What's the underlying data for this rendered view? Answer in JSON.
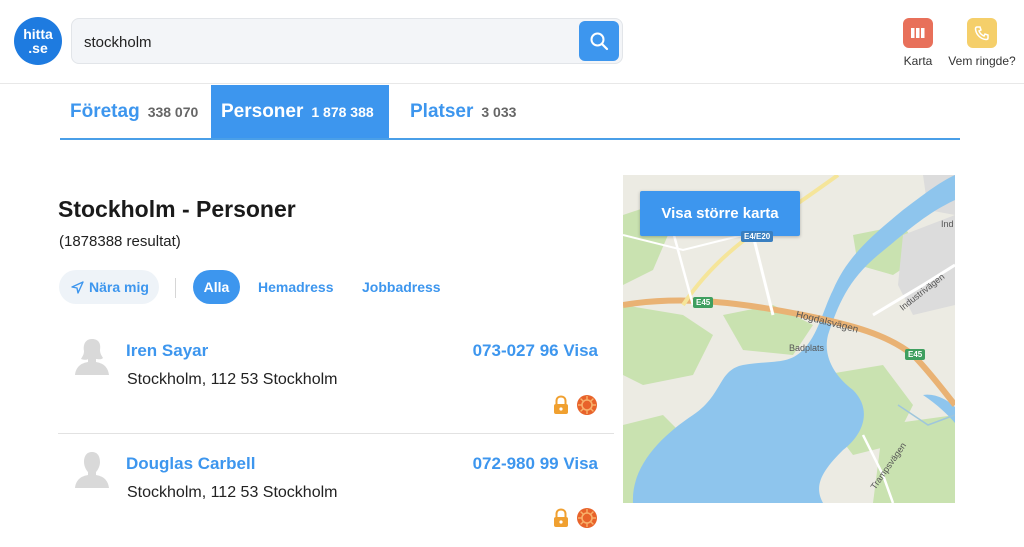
{
  "header": {
    "logo_line1": "hitta",
    "logo_line2": ".se",
    "search_value": "stockholm",
    "actions": [
      {
        "label": "Karta",
        "icon": "map-icon",
        "color": "#e8705a"
      },
      {
        "label": "Vem ringde?",
        "icon": "phone-icon",
        "color": "#f5cf6a"
      }
    ]
  },
  "tabs": [
    {
      "label": "Företag",
      "count": "338 070",
      "active": false
    },
    {
      "label": "Personer",
      "count": "1 878 388",
      "active": true
    },
    {
      "label": "Platser",
      "count": "3 033",
      "active": false
    }
  ],
  "main": {
    "title": "Stockholm - Personer",
    "results": "(1878388 resultat)"
  },
  "filters": {
    "near": "Nära mig",
    "all": "Alla",
    "home": "Hemadress",
    "work": "Jobbadress"
  },
  "people": [
    {
      "name": "Iren Sayar",
      "address": "Stockholm, 112 53 Stockholm",
      "phone": "073-027 96 Visa",
      "avatar": "female-avatar-icon"
    },
    {
      "name": "Douglas Carbell",
      "address": "Stockholm, 112 53 Stockholm",
      "phone": "072-980 99 Visa",
      "avatar": "male-avatar-icon"
    }
  ],
  "map": {
    "button": "Visa större karta",
    "labels": {
      "road": "Hogdalsvägen",
      "badplats": "Badplats",
      "industri": "Industrivägen",
      "ind": "Ind",
      "tramp": "Trampsvägen",
      "e45_a": "E45",
      "e45_b": "E45",
      "e4": "E4/E20"
    }
  },
  "colors": {
    "accent": "#3d96ee",
    "water": "#8ec5ed",
    "green": "#c9e2b0",
    "road_orange": "#e9b274"
  }
}
